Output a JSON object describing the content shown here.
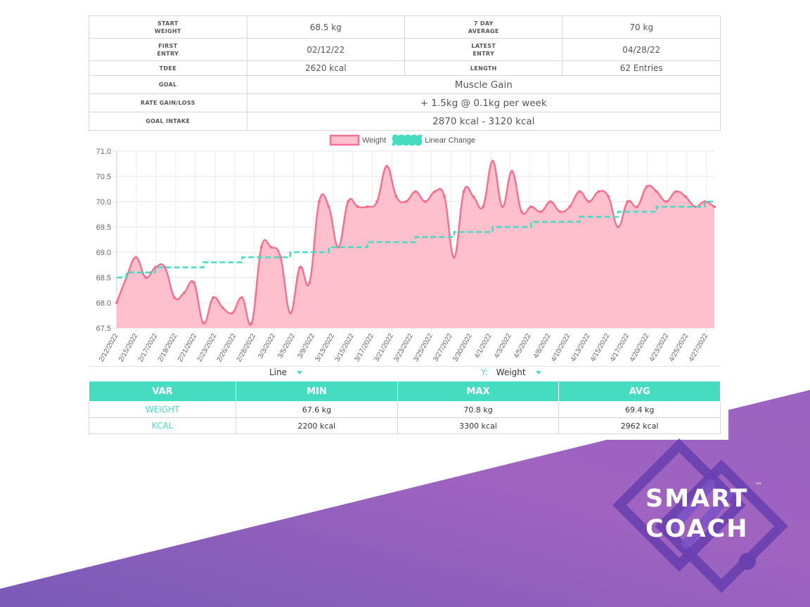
{
  "summary": {
    "start_weight_label": [
      "START",
      "WEIGHT"
    ],
    "start_weight": "68.5 kg",
    "avg7_label": [
      "7 DAY",
      "AVERAGE"
    ],
    "avg7": "70 kg",
    "first_entry_label": [
      "FIRST",
      "ENTRY"
    ],
    "first_entry": "02/12/22",
    "latest_entry_label": [
      "LATEST",
      "ENTRY"
    ],
    "latest_entry": "04/28/22",
    "tdee_label": "TDEE",
    "tdee": "2620 kcal",
    "length_label": "LENGTH",
    "length": "62 Entries",
    "goal_label": "GOAL",
    "goal": "Muscle Gain",
    "rate_label": "RATE GAIN/LOSS",
    "rate": "+ 1.5kg @ 0.1kg per week",
    "intake_label": "GOAL INTAKE",
    "intake": "2870 kcal - 3120 kcal"
  },
  "controls": {
    "chart_type": "Line",
    "y_label": "Y:",
    "y_value": "Weight"
  },
  "stats": {
    "headers": [
      "VAR",
      "MIN",
      "MAX",
      "AVG"
    ],
    "rows": [
      [
        "WEIGHT",
        "67.6 kg",
        "70.8 kg",
        "69.4 kg"
      ],
      [
        "KCAL",
        "2200 kcal",
        "3300 kcal",
        "2962 kcal"
      ]
    ]
  },
  "brand": {
    "line1": "SMART",
    "line2": "COACH",
    "tm": "™"
  },
  "colors": {
    "accent": "#45dcc2",
    "weight_line": "#f4728f",
    "weight_fill": "#ffc0cd",
    "purple": "#9a63c0"
  },
  "chart_data": {
    "type": "area",
    "ylim": [
      67.5,
      71.0
    ],
    "yticks": [
      "71.0",
      "70.5",
      "70.0",
      "69.5",
      "69.0",
      "68.5",
      "68.0",
      "67.5"
    ],
    "xticks": [
      "2/12/2022",
      "2/15/2022",
      "2/17/2022",
      "2/19/2022",
      "2/21/2022",
      "2/23/2022",
      "2/26/2022",
      "2/28/2022",
      "3/3/2022",
      "3/5/2022",
      "3/9/2022",
      "3/13/2022",
      "3/15/2022",
      "3/17/2022",
      "3/21/2022",
      "3/23/2022",
      "3/25/2022",
      "3/27/2022",
      "3/30/2022",
      "4/1/2022",
      "4/3/2022",
      "4/5/2022",
      "4/8/2022",
      "4/10/2022",
      "4/13/2022",
      "4/15/2022",
      "4/17/2022",
      "4/20/2022",
      "4/23/2022",
      "4/25/2022",
      "4/27/2022"
    ],
    "legend": "top-center",
    "grid": true,
    "series": [
      {
        "name": "Weight",
        "values": [
          68.0,
          68.5,
          68.9,
          68.5,
          68.7,
          68.7,
          68.1,
          68.2,
          68.4,
          67.6,
          68.1,
          67.9,
          67.8,
          68.1,
          67.6,
          69.1,
          69.1,
          68.9,
          67.8,
          68.7,
          68.4,
          70.0,
          69.9,
          69.1,
          70.0,
          69.9,
          69.9,
          70.0,
          70.7,
          70.1,
          70.0,
          70.2,
          70.0,
          70.2,
          70.1,
          68.9,
          70.2,
          70.1,
          69.9,
          70.8,
          69.9,
          70.6,
          69.8,
          69.9,
          69.8,
          70.0,
          69.8,
          69.9,
          70.2,
          70.0,
          70.2,
          70.1,
          69.5,
          70.0,
          69.9,
          70.3,
          70.2,
          70.0,
          70.2,
          70.1,
          69.9,
          70.0,
          69.9
        ]
      },
      {
        "name": "Linear Change",
        "values": [
          68.5,
          68.6,
          68.6,
          68.6,
          68.7,
          68.7,
          68.7,
          68.7,
          68.7,
          68.8,
          68.8,
          68.8,
          68.8,
          68.9,
          68.9,
          68.9,
          68.9,
          68.9,
          69.0,
          69.0,
          69.0,
          69.0,
          69.1,
          69.1,
          69.1,
          69.1,
          69.2,
          69.2,
          69.2,
          69.2,
          69.2,
          69.3,
          69.3,
          69.3,
          69.3,
          69.4,
          69.4,
          69.4,
          69.4,
          69.5,
          69.5,
          69.5,
          69.5,
          69.6,
          69.6,
          69.6,
          69.6,
          69.6,
          69.7,
          69.7,
          69.7,
          69.7,
          69.8,
          69.8,
          69.8,
          69.8,
          69.9,
          69.9,
          69.9,
          69.9,
          69.9,
          70.0,
          70.0
        ]
      }
    ]
  }
}
